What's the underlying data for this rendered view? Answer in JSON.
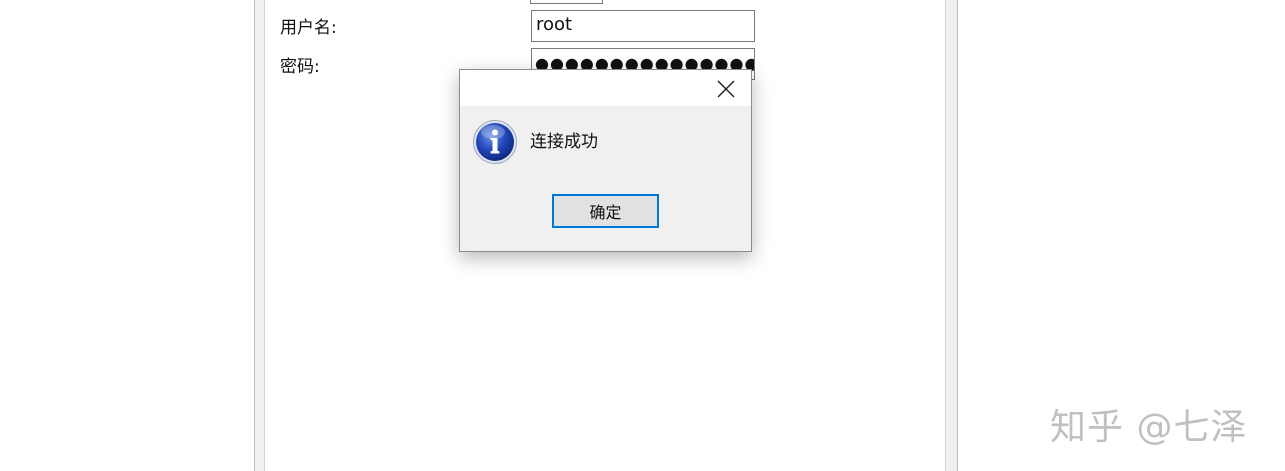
{
  "form": {
    "username_label": "用户名:",
    "username_value": "root",
    "password_label": "密码:",
    "password_value": "●●●●●●●●●●●●●●●●●●"
  },
  "dialog": {
    "close_icon": "close-icon",
    "icon": "info-icon",
    "message": "连接成功",
    "ok_label": "确定",
    "focus_color": "#0078d7"
  },
  "watermark": {
    "text": "知乎 @七泽"
  }
}
